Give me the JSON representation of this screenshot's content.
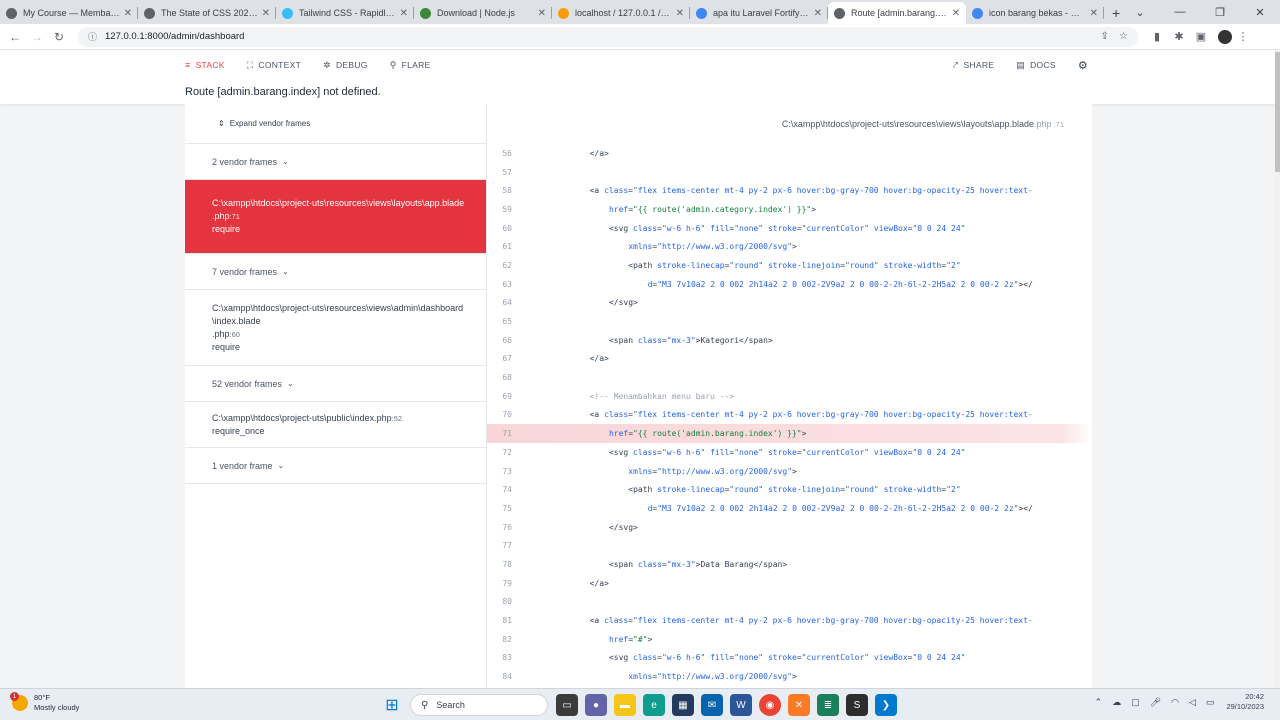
{
  "browser": {
    "tabs": [
      {
        "title": "My Course — Membangu...",
        "color": "#5f6368",
        "icon": "globe"
      },
      {
        "title": "The State of CSS 2021: CS...",
        "color": "#5f6368",
        "icon": "globe"
      },
      {
        "title": "Tailwind CSS - Rapidly bu...",
        "color": "#38bdf8",
        "icon": "tailwind"
      },
      {
        "title": "Download | Node.js",
        "color": "#3c873a",
        "icon": "node"
      },
      {
        "title": "localhost / 127.0.0.1 / db...",
        "color": "#f89c0e",
        "icon": "phpmyadmin"
      },
      {
        "title": "apa itu Laravel Fortify - Pe...",
        "color": "#4285f4",
        "icon": "google"
      },
      {
        "title": "Route [admin.barang.inde...",
        "color": "#5f6368",
        "icon": "globe",
        "active": true
      },
      {
        "title": "icon barang bekas - Goog...",
        "color": "#4285f4",
        "icon": "google"
      }
    ],
    "new_tab": "+",
    "url": "127.0.0.1:8000/admin/dashboard"
  },
  "ignition": {
    "nav": {
      "stack": "STACK",
      "context": "CONTEXT",
      "debug": "DEBUG",
      "flare": "FLARE",
      "share": "SHARE",
      "docs": "DOCS"
    },
    "error_message": "Route [admin.barang.index] not defined.",
    "expand_vendor": "Expand vendor frames",
    "frames": {
      "g1": "2 vendor frames",
      "f1_path": "C:\\xampp\\htdocs\\project-uts\\resources\\views\\layouts\\app.blade",
      "f1_ext": ".php",
      "f1_line": ":71",
      "f1_method": "require",
      "g2": "7 vendor frames",
      "f2_path": "C:\\xampp\\htdocs\\project-uts\\resources\\views\\admin\\dashboard\\index.blade",
      "f2_ext": ".php",
      "f2_line": ":60",
      "f2_method": "require",
      "g3": "52 vendor frames",
      "f3_path": "C:\\xampp\\htdocs\\project-uts\\public\\index",
      "f3_ext": ".php",
      "f3_line": ":52",
      "f3_method": "require_once",
      "g4": "1 vendor frame"
    },
    "file_header": {
      "path": "C:\\xampp\\htdocs\\project-uts\\resources\\views\\layouts\\app.blade",
      "ext": ".php",
      "line": ":71"
    },
    "highlight_line": 71,
    "code_lines": [
      {
        "n": "56",
        "indent": 14,
        "parts": [
          [
            "tg",
            "</a>"
          ]
        ]
      },
      {
        "n": "57",
        "indent": 0,
        "parts": []
      },
      {
        "n": "58",
        "indent": 14,
        "parts": [
          [
            "tg",
            "<a "
          ],
          [
            "at",
            "class"
          ],
          [
            "tg",
            "="
          ],
          [
            "at",
            "\"flex items-center mt-4 py-2 px-6 hover:bg-gray-700 hover:bg-opacity-25 hover:text-"
          ]
        ]
      },
      {
        "n": "59",
        "indent": 18,
        "parts": [
          [
            "at",
            "href"
          ],
          [
            "tg",
            "="
          ],
          [
            "vl",
            "\"{{ route('admin.category.index') }}\""
          ],
          [
            "tg",
            ">"
          ]
        ]
      },
      {
        "n": "60",
        "indent": 18,
        "parts": [
          [
            "tg",
            "<svg "
          ],
          [
            "at",
            "class"
          ],
          [
            "tg",
            "="
          ],
          [
            "at",
            "\"w-6 h-6\" "
          ],
          [
            "at",
            "fill"
          ],
          [
            "tg",
            "="
          ],
          [
            "at",
            "\"none\" "
          ],
          [
            "at",
            "stroke"
          ],
          [
            "tg",
            "="
          ],
          [
            "at",
            "\"currentColor\" "
          ],
          [
            "at",
            "viewBox"
          ],
          [
            "tg",
            "="
          ],
          [
            "at",
            "\"0 0 24 24\""
          ]
        ]
      },
      {
        "n": "61",
        "indent": 22,
        "parts": [
          [
            "at",
            "xmlns"
          ],
          [
            "tg",
            "="
          ],
          [
            "at",
            "\"http://www.w3.org/2000/svg\""
          ],
          [
            "tg",
            ">"
          ]
        ]
      },
      {
        "n": "62",
        "indent": 22,
        "parts": [
          [
            "tg",
            "<path "
          ],
          [
            "at",
            "stroke-linecap"
          ],
          [
            "tg",
            "="
          ],
          [
            "at",
            "\"round\" "
          ],
          [
            "at",
            "stroke-linejoin"
          ],
          [
            "tg",
            "="
          ],
          [
            "at",
            "\"round\" "
          ],
          [
            "at",
            "stroke-width"
          ],
          [
            "tg",
            "="
          ],
          [
            "at",
            "\"2\""
          ]
        ]
      },
      {
        "n": "63",
        "indent": 26,
        "parts": [
          [
            "at",
            "d"
          ],
          [
            "tg",
            "="
          ],
          [
            "at",
            "\"M3 7v10a2 2 0 002 2h14a2 2 0 002-2V9a2 2 0 00-2-2h-6l-2-2H5a2 2 0 00-2 2z\""
          ],
          [
            "tg",
            "></"
          ]
        ]
      },
      {
        "n": "64",
        "indent": 18,
        "parts": [
          [
            "tg",
            "</svg>"
          ]
        ]
      },
      {
        "n": "65",
        "indent": 0,
        "parts": []
      },
      {
        "n": "66",
        "indent": 18,
        "parts": [
          [
            "tg",
            "<span "
          ],
          [
            "at",
            "class"
          ],
          [
            "tg",
            "="
          ],
          [
            "at",
            "\"mx-3\""
          ],
          [
            "tg",
            ">Kategori</span>"
          ]
        ]
      },
      {
        "n": "67",
        "indent": 14,
        "parts": [
          [
            "tg",
            "</a>"
          ]
        ]
      },
      {
        "n": "68",
        "indent": 0,
        "parts": []
      },
      {
        "n": "69",
        "indent": 14,
        "parts": [
          [
            "cm",
            "<!-- Menambahkan menu baru -->"
          ]
        ]
      },
      {
        "n": "70",
        "indent": 14,
        "parts": [
          [
            "tg",
            "<a "
          ],
          [
            "at",
            "class"
          ],
          [
            "tg",
            "="
          ],
          [
            "at",
            "\"flex items-center mt-4 py-2 px-6 hover:bg-gray-700 hover:bg-opacity-25 hover:text-"
          ]
        ]
      },
      {
        "n": "71",
        "indent": 18,
        "parts": [
          [
            "at",
            "href"
          ],
          [
            "tg",
            "="
          ],
          [
            "vl",
            "\"{{ route('admin.barang.index') }}\""
          ],
          [
            "tg",
            ">"
          ]
        ]
      },
      {
        "n": "72",
        "indent": 18,
        "parts": [
          [
            "tg",
            "<svg "
          ],
          [
            "at",
            "class"
          ],
          [
            "tg",
            "="
          ],
          [
            "at",
            "\"w-6 h-6\" "
          ],
          [
            "at",
            "fill"
          ],
          [
            "tg",
            "="
          ],
          [
            "at",
            "\"none\" "
          ],
          [
            "at",
            "stroke"
          ],
          [
            "tg",
            "="
          ],
          [
            "at",
            "\"currentColor\" "
          ],
          [
            "at",
            "viewBox"
          ],
          [
            "tg",
            "="
          ],
          [
            "at",
            "\"0 0 24 24\""
          ]
        ]
      },
      {
        "n": "73",
        "indent": 22,
        "parts": [
          [
            "at",
            "xmlns"
          ],
          [
            "tg",
            "="
          ],
          [
            "at",
            "\"http://www.w3.org/2000/svg\""
          ],
          [
            "tg",
            ">"
          ]
        ]
      },
      {
        "n": "74",
        "indent": 22,
        "parts": [
          [
            "tg",
            "<path "
          ],
          [
            "at",
            "stroke-linecap"
          ],
          [
            "tg",
            "="
          ],
          [
            "at",
            "\"round\" "
          ],
          [
            "at",
            "stroke-linejoin"
          ],
          [
            "tg",
            "="
          ],
          [
            "at",
            "\"round\" "
          ],
          [
            "at",
            "stroke-width"
          ],
          [
            "tg",
            "="
          ],
          [
            "at",
            "\"2\""
          ]
        ]
      },
      {
        "n": "75",
        "indent": 26,
        "parts": [
          [
            "at",
            "d"
          ],
          [
            "tg",
            "="
          ],
          [
            "at",
            "\"M3 7v10a2 2 0 002 2h14a2 2 0 002-2V9a2 2 0 00-2-2h-6l-2-2H5a2 2 0 00-2 2z\""
          ],
          [
            "tg",
            "></"
          ]
        ]
      },
      {
        "n": "76",
        "indent": 18,
        "parts": [
          [
            "tg",
            "</svg>"
          ]
        ]
      },
      {
        "n": "77",
        "indent": 0,
        "parts": []
      },
      {
        "n": "78",
        "indent": 18,
        "parts": [
          [
            "tg",
            "<span "
          ],
          [
            "at",
            "class"
          ],
          [
            "tg",
            "="
          ],
          [
            "at",
            "\"mx-3\""
          ],
          [
            "tg",
            ">Data Barang</span>"
          ]
        ]
      },
      {
        "n": "79",
        "indent": 14,
        "parts": [
          [
            "tg",
            "</a>"
          ]
        ]
      },
      {
        "n": "80",
        "indent": 0,
        "parts": []
      },
      {
        "n": "81",
        "indent": 14,
        "parts": [
          [
            "tg",
            "<a "
          ],
          [
            "at",
            "class"
          ],
          [
            "tg",
            "="
          ],
          [
            "at",
            "\"flex items-center mt-4 py-2 px-6 hover:bg-gray-700 hover:bg-opacity-25 hover:text-"
          ]
        ]
      },
      {
        "n": "82",
        "indent": 18,
        "parts": [
          [
            "at",
            "href"
          ],
          [
            "tg",
            "="
          ],
          [
            "vl",
            "\"#\""
          ],
          [
            "tg",
            ">"
          ]
        ]
      },
      {
        "n": "83",
        "indent": 18,
        "parts": [
          [
            "tg",
            "<svg "
          ],
          [
            "at",
            "class"
          ],
          [
            "tg",
            "="
          ],
          [
            "at",
            "\"w-6 h-6\" "
          ],
          [
            "at",
            "fill"
          ],
          [
            "tg",
            "="
          ],
          [
            "at",
            "\"none\" "
          ],
          [
            "at",
            "stroke"
          ],
          [
            "tg",
            "="
          ],
          [
            "at",
            "\"currentColor\" "
          ],
          [
            "at",
            "viewBox"
          ],
          [
            "tg",
            "="
          ],
          [
            "at",
            "\"0 0 24 24\""
          ]
        ]
      },
      {
        "n": "84",
        "indent": 22,
        "parts": [
          [
            "at",
            "xmlns"
          ],
          [
            "tg",
            "="
          ],
          [
            "at",
            "\"http://www.w3.org/2000/svg\""
          ],
          [
            "tg",
            ">"
          ]
        ]
      }
    ]
  },
  "taskbar": {
    "weather_temp": "80°F",
    "weather_desc": "Mostly cloudy",
    "weather_badge": "1",
    "search": "Search",
    "time": "20:42",
    "date": "29/10/2023"
  }
}
